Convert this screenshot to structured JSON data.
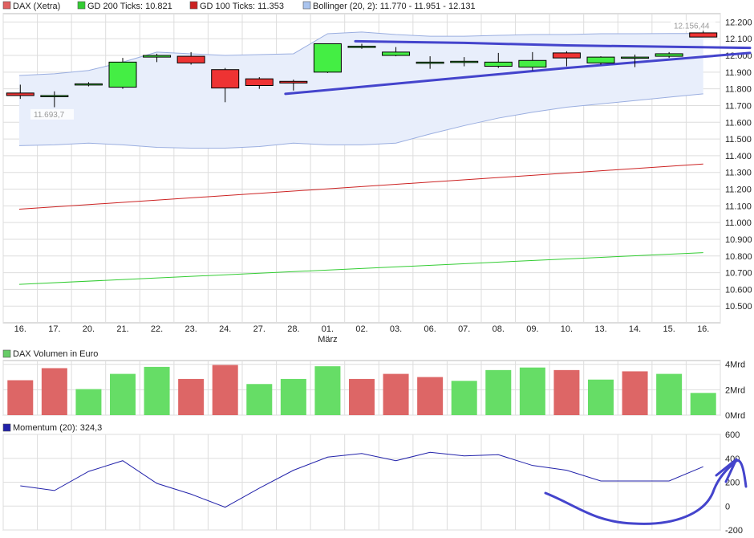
{
  "chart_data": {
    "type": "candlestick",
    "legend": [
      {
        "label": "DAX (Xetra)",
        "color": "#e06060"
      },
      {
        "label": "GD 200 Ticks: 10.821",
        "color": "#33cc33"
      },
      {
        "label": "GD 100 Ticks: 11.353",
        "color": "#cc2222"
      },
      {
        "label": "Bollinger (20, 2): 11.770 - 11.951 - 12.131",
        "color": "#aac4ee"
      }
    ],
    "categories": [
      "16.",
      "17.",
      "20.",
      "21.",
      "22.",
      "23.",
      "24.",
      "27.",
      "28.",
      "01.",
      "02.",
      "03.",
      "06.",
      "07.",
      "08.",
      "09.",
      "10.",
      "13.",
      "14.",
      "15.",
      "16."
    ],
    "month_label": "März",
    "price_axis": {
      "min": 10400,
      "max": 12250,
      "ticks": [
        12200,
        12100,
        12000,
        11900,
        11800,
        11700,
        11600,
        11500,
        11400,
        11300,
        11200,
        11100,
        11000,
        10900,
        10800,
        10700,
        10600,
        10500
      ],
      "tick_labels": [
        "12.200",
        "12.100",
        "12.000",
        "11.900",
        "11.800",
        "11.700",
        "11.600",
        "11.500",
        "11.400",
        "11.300",
        "11.200",
        "11.100",
        "11.000",
        "10.900",
        "10.800",
        "10.700",
        "10.600",
        "10.500"
      ]
    },
    "candles": [
      {
        "o": 11775,
        "h": 11825,
        "l": 11740,
        "c": 11760
      },
      {
        "o": 11760,
        "h": 11785,
        "l": 11690,
        "c": 11760
      },
      {
        "o": 11825,
        "h": 11840,
        "l": 11815,
        "c": 11830
      },
      {
        "o": 11810,
        "h": 11985,
        "l": 11800,
        "c": 11960
      },
      {
        "o": 11990,
        "h": 12010,
        "l": 11960,
        "c": 12000
      },
      {
        "o": 11995,
        "h": 12020,
        "l": 11945,
        "c": 11955
      },
      {
        "o": 11915,
        "h": 11925,
        "l": 11720,
        "c": 11805
      },
      {
        "o": 11860,
        "h": 11870,
        "l": 11800,
        "c": 11820
      },
      {
        "o": 11845,
        "h": 11855,
        "l": 11790,
        "c": 11835
      },
      {
        "o": 11900,
        "h": 12070,
        "l": 11895,
        "c": 12070
      },
      {
        "o": 12055,
        "h": 12070,
        "l": 12040,
        "c": 12055
      },
      {
        "o": 12000,
        "h": 12050,
        "l": 11995,
        "c": 12020
      },
      {
        "o": 11960,
        "h": 11995,
        "l": 11920,
        "c": 11960
      },
      {
        "o": 11965,
        "h": 11990,
        "l": 11935,
        "c": 11965
      },
      {
        "o": 11935,
        "h": 12015,
        "l": 11925,
        "c": 11960
      },
      {
        "o": 11930,
        "h": 12020,
        "l": 11910,
        "c": 11970
      },
      {
        "o": 12015,
        "h": 12025,
        "l": 11935,
        "c": 11985
      },
      {
        "o": 11955,
        "h": 11995,
        "l": 11945,
        "c": 11990
      },
      {
        "o": 11990,
        "h": 12005,
        "l": 11930,
        "c": 11990
      },
      {
        "o": 11995,
        "h": 12020,
        "l": 11985,
        "c": 12010
      },
      {
        "o": 12135,
        "h": 12156,
        "l": 12110,
        "c": 12110
      }
    ],
    "high_label": "12.156,44",
    "low_label": "11.693,7",
    "gd200": [
      10630,
      10820
    ],
    "gd100": [
      11080,
      11350
    ],
    "bollinger_upper": [
      11880,
      11890,
      11910,
      11960,
      12020,
      12010,
      12000,
      12005,
      12010,
      12130,
      12140,
      12125,
      12115,
      12115,
      12120,
      12125,
      12125,
      12130,
      12130,
      12131,
      12131
    ],
    "bollinger_lower": [
      11460,
      11465,
      11475,
      11465,
      11450,
      11445,
      11445,
      11455,
      11475,
      11465,
      11465,
      11475,
      11530,
      11580,
      11625,
      11660,
      11690,
      11710,
      11730,
      11750,
      11770
    ],
    "volume": {
      "label": "DAX Volumen in Euro",
      "axis_labels": [
        "4Mrd",
        "2Mrd",
        "0Mrd"
      ],
      "max": 4.3,
      "values": [
        2.75,
        3.7,
        2.05,
        3.25,
        3.8,
        2.85,
        3.95,
        2.45,
        2.85,
        3.85,
        2.85,
        3.25,
        3.0,
        2.7,
        3.55,
        3.75,
        3.55,
        2.8,
        3.45,
        3.25,
        1.75
      ],
      "up": [
        false,
        false,
        true,
        true,
        true,
        false,
        false,
        true,
        true,
        true,
        false,
        false,
        false,
        true,
        true,
        true,
        false,
        true,
        false,
        true,
        true
      ]
    },
    "momentum": {
      "label": "Momentum (20): 324,3",
      "axis": {
        "min": -200,
        "max": 600,
        "ticks": [
          600,
          400,
          200,
          0,
          -200
        ],
        "tick_labels": [
          "600",
          "400",
          "200",
          "0",
          "-200"
        ]
      },
      "values": [
        170,
        130,
        290,
        380,
        190,
        100,
        -10,
        150,
        300,
        410,
        440,
        380,
        450,
        420,
        430,
        340,
        300,
        210,
        210,
        210,
        330
      ]
    },
    "colors": {
      "up": "#44ee44",
      "down": "#ee3333",
      "vol_up": "#66dd66",
      "vol_down": "#dd6666",
      "bollinger_fill": "#e8eefb",
      "bollinger_line": "#9aaee0",
      "drawing": "#4444cc",
      "momentum": "#2222aa",
      "grid": "#dddddd"
    }
  }
}
